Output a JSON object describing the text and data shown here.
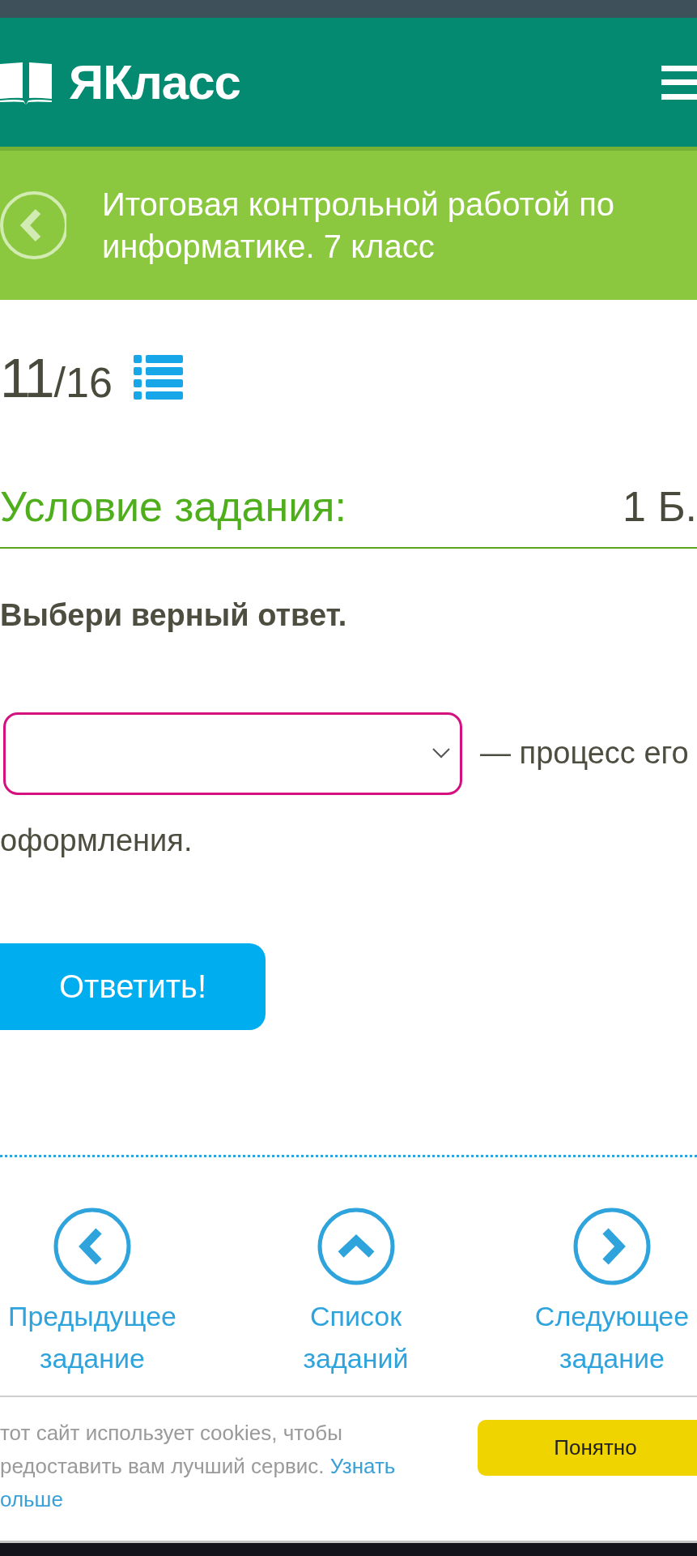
{
  "header": {
    "logo": "ЯКласс"
  },
  "banner": {
    "title": "Итоговая контрольной работой по информатике. 7 класс"
  },
  "progress": {
    "current": "11",
    "total": "/16"
  },
  "task": {
    "heading": "Условие задания:",
    "points": "1 Б.",
    "instruction": "Выбери верный ответ.",
    "sentence_lines": [
      [
        {
          "kind": "dropdown"
        },
        {
          "kind": "text",
          "text": "— процесс его"
        }
      ],
      [
        {
          "kind": "text",
          "text": "оформления."
        }
      ]
    ],
    "submit": "Ответить!"
  },
  "navigation": [
    {
      "kind": "previous",
      "label": "Предыдущее задание"
    },
    {
      "kind": "list",
      "label": "Список заданий"
    },
    {
      "kind": "next",
      "label": "Следующее задание"
    }
  ],
  "cookie_notice": {
    "lines": [
      "тот сайт использует cookies, чтобы",
      "редоставить вам лучший сервис."
    ],
    "link_lines": [
      "Узнать",
      "ольше"
    ],
    "button": "Понятно"
  }
}
